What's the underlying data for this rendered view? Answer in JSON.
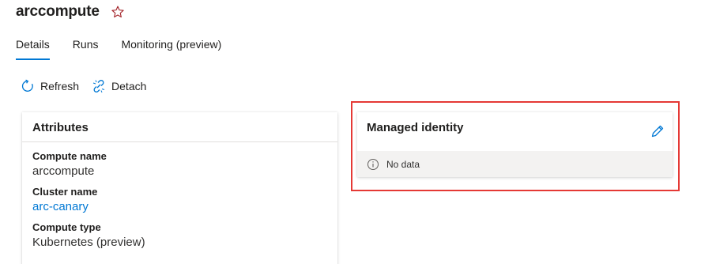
{
  "header": {
    "title": "arccompute",
    "favorite_icon": "star-outline-icon"
  },
  "tabs": [
    {
      "label": "Details",
      "active": true
    },
    {
      "label": "Runs",
      "active": false
    },
    {
      "label": "Monitoring (preview)",
      "active": false
    }
  ],
  "toolbar": {
    "refresh_label": "Refresh",
    "detach_label": "Detach"
  },
  "attributes": {
    "title": "Attributes",
    "items": [
      {
        "label": "Compute name",
        "value": "arccompute"
      },
      {
        "label": "Cluster name",
        "value": "arc-canary"
      },
      {
        "label": "Compute type",
        "value": "Kubernetes (preview)"
      }
    ]
  },
  "managed_identity": {
    "title": "Managed identity",
    "empty_text": "No data"
  },
  "colors": {
    "accent": "#0078d4",
    "highlight": "#e53935"
  }
}
